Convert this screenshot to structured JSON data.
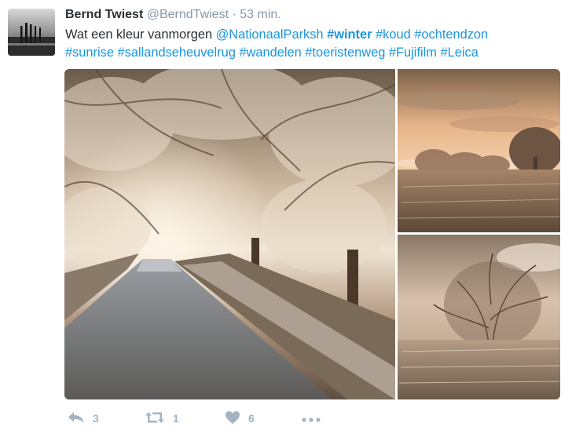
{
  "author": {
    "display_name": "Bernd Twiest",
    "handle": "@BerndTwiest",
    "separator": "·",
    "timestamp": "53 min."
  },
  "tweet": {
    "text_lead": "Wat een kleur vanmorgen",
    "tokens": [
      {
        "text": "@NationaalParksh",
        "type": "mention"
      },
      {
        "text": "#winter",
        "type": "hashtag",
        "bold": true
      },
      {
        "text": "#koud",
        "type": "hashtag"
      },
      {
        "text": "#ochtendzon",
        "type": "hashtag"
      }
    ],
    "line2": [
      {
        "text": "#sunrise",
        "type": "hashtag"
      },
      {
        "text": "#sallandseheuvelrug",
        "type": "hashtag"
      },
      {
        "text": "#wandelen",
        "type": "hashtag"
      },
      {
        "text": "#toeristenweg",
        "type": "hashtag"
      },
      {
        "text": "#Fujifilm",
        "type": "hashtag"
      },
      {
        "text": "#Leica",
        "type": "hashtag"
      }
    ]
  },
  "actions": {
    "reply_count": "3",
    "retweet_count": "1",
    "like_count": "6"
  },
  "colors": {
    "link": "#1b95e0",
    "name": "#292f33",
    "meta": "#8899a6",
    "action": "#a3b3c1"
  },
  "icons": {
    "reply": "reply-arrow-icon",
    "retweet": "retweet-icon",
    "like": "heart-icon",
    "more": "ellipsis-icon"
  }
}
